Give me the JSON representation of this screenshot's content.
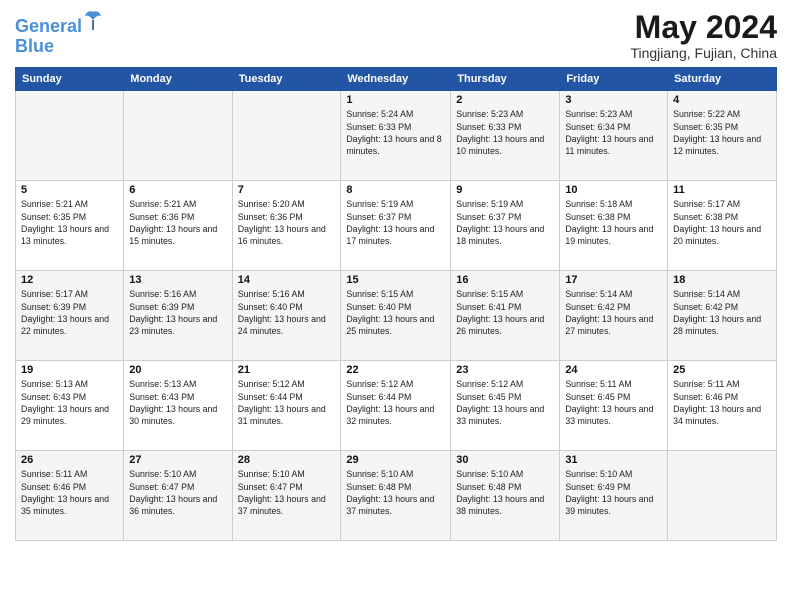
{
  "header": {
    "logo_line1": "General",
    "logo_line2": "Blue",
    "month_year": "May 2024",
    "location": "Tingjiang, Fujian, China"
  },
  "weekdays": [
    "Sunday",
    "Monday",
    "Tuesday",
    "Wednesday",
    "Thursday",
    "Friday",
    "Saturday"
  ],
  "weeks": [
    [
      {
        "day": "",
        "sunrise": "",
        "sunset": "",
        "daylight": ""
      },
      {
        "day": "",
        "sunrise": "",
        "sunset": "",
        "daylight": ""
      },
      {
        "day": "",
        "sunrise": "",
        "sunset": "",
        "daylight": ""
      },
      {
        "day": "1",
        "sunrise": "Sunrise: 5:24 AM",
        "sunset": "Sunset: 6:33 PM",
        "daylight": "Daylight: 13 hours and 8 minutes."
      },
      {
        "day": "2",
        "sunrise": "Sunrise: 5:23 AM",
        "sunset": "Sunset: 6:33 PM",
        "daylight": "Daylight: 13 hours and 10 minutes."
      },
      {
        "day": "3",
        "sunrise": "Sunrise: 5:23 AM",
        "sunset": "Sunset: 6:34 PM",
        "daylight": "Daylight: 13 hours and 11 minutes."
      },
      {
        "day": "4",
        "sunrise": "Sunrise: 5:22 AM",
        "sunset": "Sunset: 6:35 PM",
        "daylight": "Daylight: 13 hours and 12 minutes."
      }
    ],
    [
      {
        "day": "5",
        "sunrise": "Sunrise: 5:21 AM",
        "sunset": "Sunset: 6:35 PM",
        "daylight": "Daylight: 13 hours and 13 minutes."
      },
      {
        "day": "6",
        "sunrise": "Sunrise: 5:21 AM",
        "sunset": "Sunset: 6:36 PM",
        "daylight": "Daylight: 13 hours and 15 minutes."
      },
      {
        "day": "7",
        "sunrise": "Sunrise: 5:20 AM",
        "sunset": "Sunset: 6:36 PM",
        "daylight": "Daylight: 13 hours and 16 minutes."
      },
      {
        "day": "8",
        "sunrise": "Sunrise: 5:19 AM",
        "sunset": "Sunset: 6:37 PM",
        "daylight": "Daylight: 13 hours and 17 minutes."
      },
      {
        "day": "9",
        "sunrise": "Sunrise: 5:19 AM",
        "sunset": "Sunset: 6:37 PM",
        "daylight": "Daylight: 13 hours and 18 minutes."
      },
      {
        "day": "10",
        "sunrise": "Sunrise: 5:18 AM",
        "sunset": "Sunset: 6:38 PM",
        "daylight": "Daylight: 13 hours and 19 minutes."
      },
      {
        "day": "11",
        "sunrise": "Sunrise: 5:17 AM",
        "sunset": "Sunset: 6:38 PM",
        "daylight": "Daylight: 13 hours and 20 minutes."
      }
    ],
    [
      {
        "day": "12",
        "sunrise": "Sunrise: 5:17 AM",
        "sunset": "Sunset: 6:39 PM",
        "daylight": "Daylight: 13 hours and 22 minutes."
      },
      {
        "day": "13",
        "sunrise": "Sunrise: 5:16 AM",
        "sunset": "Sunset: 6:39 PM",
        "daylight": "Daylight: 13 hours and 23 minutes."
      },
      {
        "day": "14",
        "sunrise": "Sunrise: 5:16 AM",
        "sunset": "Sunset: 6:40 PM",
        "daylight": "Daylight: 13 hours and 24 minutes."
      },
      {
        "day": "15",
        "sunrise": "Sunrise: 5:15 AM",
        "sunset": "Sunset: 6:40 PM",
        "daylight": "Daylight: 13 hours and 25 minutes."
      },
      {
        "day": "16",
        "sunrise": "Sunrise: 5:15 AM",
        "sunset": "Sunset: 6:41 PM",
        "daylight": "Daylight: 13 hours and 26 minutes."
      },
      {
        "day": "17",
        "sunrise": "Sunrise: 5:14 AM",
        "sunset": "Sunset: 6:42 PM",
        "daylight": "Daylight: 13 hours and 27 minutes."
      },
      {
        "day": "18",
        "sunrise": "Sunrise: 5:14 AM",
        "sunset": "Sunset: 6:42 PM",
        "daylight": "Daylight: 13 hours and 28 minutes."
      }
    ],
    [
      {
        "day": "19",
        "sunrise": "Sunrise: 5:13 AM",
        "sunset": "Sunset: 6:43 PM",
        "daylight": "Daylight: 13 hours and 29 minutes."
      },
      {
        "day": "20",
        "sunrise": "Sunrise: 5:13 AM",
        "sunset": "Sunset: 6:43 PM",
        "daylight": "Daylight: 13 hours and 30 minutes."
      },
      {
        "day": "21",
        "sunrise": "Sunrise: 5:12 AM",
        "sunset": "Sunset: 6:44 PM",
        "daylight": "Daylight: 13 hours and 31 minutes."
      },
      {
        "day": "22",
        "sunrise": "Sunrise: 5:12 AM",
        "sunset": "Sunset: 6:44 PM",
        "daylight": "Daylight: 13 hours and 32 minutes."
      },
      {
        "day": "23",
        "sunrise": "Sunrise: 5:12 AM",
        "sunset": "Sunset: 6:45 PM",
        "daylight": "Daylight: 13 hours and 33 minutes."
      },
      {
        "day": "24",
        "sunrise": "Sunrise: 5:11 AM",
        "sunset": "Sunset: 6:45 PM",
        "daylight": "Daylight: 13 hours and 33 minutes."
      },
      {
        "day": "25",
        "sunrise": "Sunrise: 5:11 AM",
        "sunset": "Sunset: 6:46 PM",
        "daylight": "Daylight: 13 hours and 34 minutes."
      }
    ],
    [
      {
        "day": "26",
        "sunrise": "Sunrise: 5:11 AM",
        "sunset": "Sunset: 6:46 PM",
        "daylight": "Daylight: 13 hours and 35 minutes."
      },
      {
        "day": "27",
        "sunrise": "Sunrise: 5:10 AM",
        "sunset": "Sunset: 6:47 PM",
        "daylight": "Daylight: 13 hours and 36 minutes."
      },
      {
        "day": "28",
        "sunrise": "Sunrise: 5:10 AM",
        "sunset": "Sunset: 6:47 PM",
        "daylight": "Daylight: 13 hours and 37 minutes."
      },
      {
        "day": "29",
        "sunrise": "Sunrise: 5:10 AM",
        "sunset": "Sunset: 6:48 PM",
        "daylight": "Daylight: 13 hours and 37 minutes."
      },
      {
        "day": "30",
        "sunrise": "Sunrise: 5:10 AM",
        "sunset": "Sunset: 6:48 PM",
        "daylight": "Daylight: 13 hours and 38 minutes."
      },
      {
        "day": "31",
        "sunrise": "Sunrise: 5:10 AM",
        "sunset": "Sunset: 6:49 PM",
        "daylight": "Daylight: 13 hours and 39 minutes."
      },
      {
        "day": "",
        "sunrise": "",
        "sunset": "",
        "daylight": ""
      }
    ]
  ]
}
